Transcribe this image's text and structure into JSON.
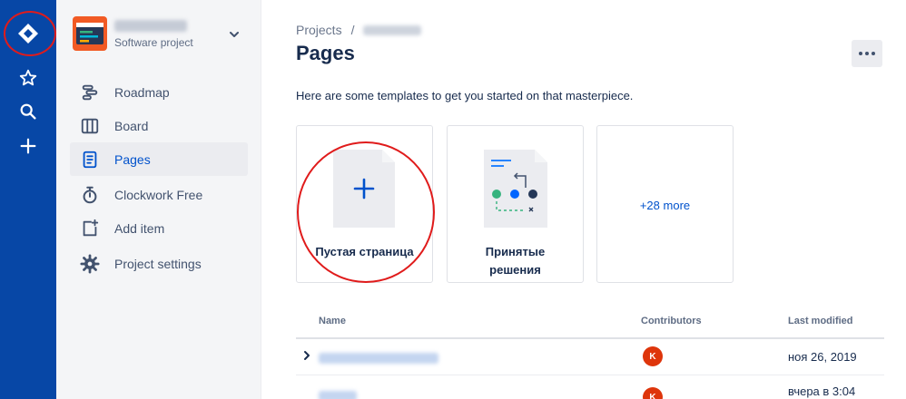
{
  "sidebar": {
    "project_type": "Software project",
    "items": [
      {
        "label": "Roadmap",
        "icon": "roadmap-icon"
      },
      {
        "label": "Board",
        "icon": "board-icon"
      },
      {
        "label": "Pages",
        "icon": "pages-icon",
        "active": true
      },
      {
        "label": "Clockwork Free",
        "icon": "stopwatch-icon"
      },
      {
        "label": "Add item",
        "icon": "add-item-icon"
      },
      {
        "label": "Project settings",
        "icon": "gear-icon"
      }
    ]
  },
  "header": {
    "breadcrumb_root": "Projects",
    "breadcrumb_sep": "/",
    "title": "Pages"
  },
  "intro": "Here are some templates to get you started on that masterpiece.",
  "templates": [
    {
      "label": "Пустая страница"
    },
    {
      "label_line1": "Принятые",
      "label_line2": "решения"
    },
    {
      "label": "+28 more"
    }
  ],
  "table": {
    "columns": [
      "Name",
      "Contributors",
      "Last modified"
    ],
    "rows": [
      {
        "contributor_initial": "K",
        "modified": "ноя 26, 2019"
      },
      {
        "contributor_initial": "K",
        "modified": "вчера в 3:04"
      }
    ]
  },
  "colors": {
    "rail": "#0747a6",
    "accent": "#0052cc",
    "annotation": "#e01b1b",
    "avatar": "#de350b"
  }
}
